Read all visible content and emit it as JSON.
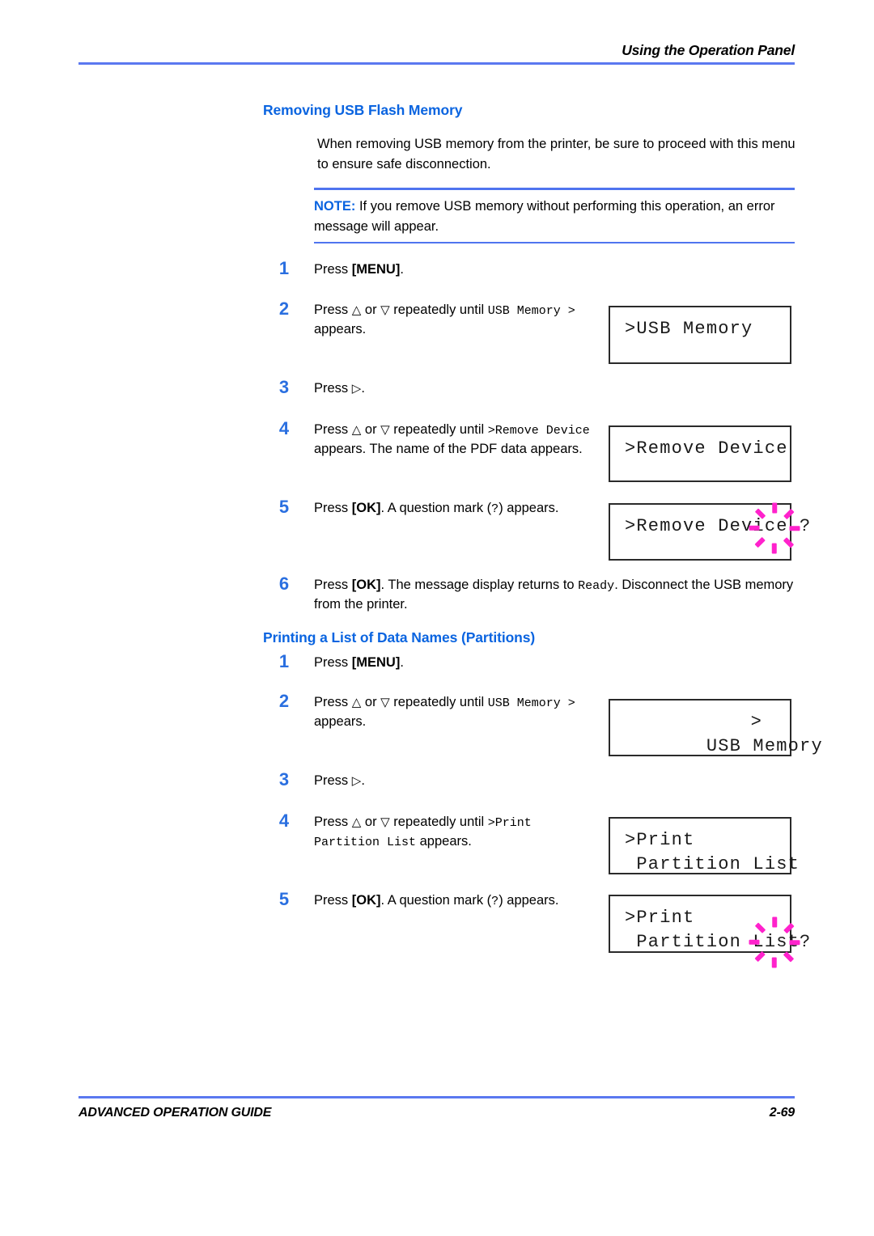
{
  "header": {
    "title": "Using the Operation Panel"
  },
  "footer": {
    "guide": "ADVANCED OPERATION GUIDE",
    "page": "2-69"
  },
  "colors": {
    "heading_blue": "#0a64e0",
    "rule_blue": "#5b78f0",
    "step_number_blue": "#2a6fe0",
    "blink_magenta": "#ff22cc",
    "lcd_border": "#2a2a2a"
  },
  "sections": [
    {
      "heading": "Removing USB Flash Memory",
      "intro": "When removing USB memory from the printer, be sure to proceed with this menu to ensure safe disconnection.",
      "note": {
        "label": "NOTE:",
        "text": "If you remove USB memory without performing this operation, an error message will appear."
      },
      "steps": [
        {
          "number": "1",
          "text_parts": [
            {
              "kind": "plain",
              "text": "Press "
            },
            {
              "kind": "key",
              "text": "[MENU]"
            },
            {
              "kind": "plain",
              "text": "."
            }
          ]
        },
        {
          "number": "2",
          "text_parts": [
            {
              "kind": "plain",
              "text": "Press "
            },
            {
              "kind": "glyph",
              "text": "△"
            },
            {
              "kind": "plain",
              "text": " or "
            },
            {
              "kind": "glyph",
              "text": "▽"
            },
            {
              "kind": "plain",
              "text": " repeatedly until "
            },
            {
              "kind": "mono",
              "text": "USB Memory >"
            },
            {
              "kind": "plain",
              "text": " appears."
            }
          ]
        },
        {
          "number": "3",
          "text_parts": [
            {
              "kind": "plain",
              "text": "Press "
            },
            {
              "kind": "glyph",
              "text": "▷"
            },
            {
              "kind": "plain",
              "text": "."
            }
          ]
        },
        {
          "number": "4",
          "text_parts": [
            {
              "kind": "plain",
              "text": "Press "
            },
            {
              "kind": "glyph",
              "text": "△"
            },
            {
              "kind": "plain",
              "text": " or "
            },
            {
              "kind": "glyph",
              "text": "▽"
            },
            {
              "kind": "plain",
              "text": " repeatedly until "
            },
            {
              "kind": "mono",
              "text": ">Remove Device"
            },
            {
              "kind": "plain",
              "text": " appears. The name of the PDF data appears."
            }
          ]
        },
        {
          "number": "5",
          "text_parts": [
            {
              "kind": "plain",
              "text": "Press "
            },
            {
              "kind": "key",
              "text": "[OK]"
            },
            {
              "kind": "plain",
              "text": ". A question mark ("
            },
            {
              "kind": "mono",
              "text": "?"
            },
            {
              "kind": "plain",
              "text": ") appears."
            }
          ]
        },
        {
          "number": "6",
          "text_parts": [
            {
              "kind": "plain",
              "text": "Press "
            },
            {
              "kind": "key",
              "text": "[OK]"
            },
            {
              "kind": "plain",
              "text": ". The message display returns to "
            },
            {
              "kind": "mono",
              "text": "Ready"
            },
            {
              "kind": "plain",
              "text": ". Disconnect the USB memory from the printer."
            }
          ]
        }
      ]
    },
    {
      "heading": "Printing a List of Data Names (Partitions)",
      "steps": [
        {
          "number": "1",
          "text_parts": [
            {
              "kind": "plain",
              "text": "Press "
            },
            {
              "kind": "key",
              "text": "[MENU]"
            },
            {
              "kind": "plain",
              "text": "."
            }
          ]
        },
        {
          "number": "2",
          "text_parts": [
            {
              "kind": "plain",
              "text": "Press "
            },
            {
              "kind": "glyph",
              "text": "△"
            },
            {
              "kind": "plain",
              "text": " or "
            },
            {
              "kind": "glyph",
              "text": "▽"
            },
            {
              "kind": "plain",
              "text": " repeatedly until "
            },
            {
              "kind": "mono",
              "text": "USB Memory >"
            },
            {
              "kind": "plain",
              "text": " appears."
            }
          ]
        },
        {
          "number": "3",
          "text_parts": [
            {
              "kind": "plain",
              "text": "Press "
            },
            {
              "kind": "glyph",
              "text": "▷"
            },
            {
              "kind": "plain",
              "text": "."
            }
          ]
        },
        {
          "number": "4",
          "text_parts": [
            {
              "kind": "plain",
              "text": "Press "
            },
            {
              "kind": "glyph",
              "text": "△"
            },
            {
              "kind": "plain",
              "text": " or "
            },
            {
              "kind": "glyph",
              "text": "▽"
            },
            {
              "kind": "plain",
              "text": " repeatedly until "
            },
            {
              "kind": "mono",
              "text": ">Print Partition List"
            },
            {
              "kind": "plain",
              "text": " appears."
            }
          ]
        },
        {
          "number": "5",
          "text_parts": [
            {
              "kind": "plain",
              "text": "Press "
            },
            {
              "kind": "key",
              "text": "[OK]"
            },
            {
              "kind": "plain",
              "text": ". A question mark ("
            },
            {
              "kind": "mono",
              "text": "?"
            },
            {
              "kind": "plain",
              "text": ") appears."
            }
          ]
        }
      ]
    }
  ],
  "lcd_panels": [
    {
      "id": "lcd-usb-memory-1",
      "line1": ">USB Memory",
      "line2": "",
      "right_marker": "",
      "blinking": false
    },
    {
      "id": "lcd-remove-device",
      "line1": ">Remove Device",
      "line2": "",
      "right_marker": "",
      "blinking": false
    },
    {
      "id": "lcd-remove-device-confirm",
      "line1": ">Remove Device ?",
      "line2": "",
      "right_marker": "",
      "blinking": true
    },
    {
      "id": "lcd-usb-memory-2",
      "line1": " USB Memory",
      "line2": "",
      "right_marker": ">",
      "blinking": false
    },
    {
      "id": "lcd-print-partition-list",
      "line1": ">Print",
      "line2": " Partition List",
      "right_marker": "",
      "blinking": false
    },
    {
      "id": "lcd-print-partition-list-confirm",
      "line1": ">Print",
      "line2": " Partition List?",
      "right_marker": "",
      "blinking": true
    }
  ]
}
